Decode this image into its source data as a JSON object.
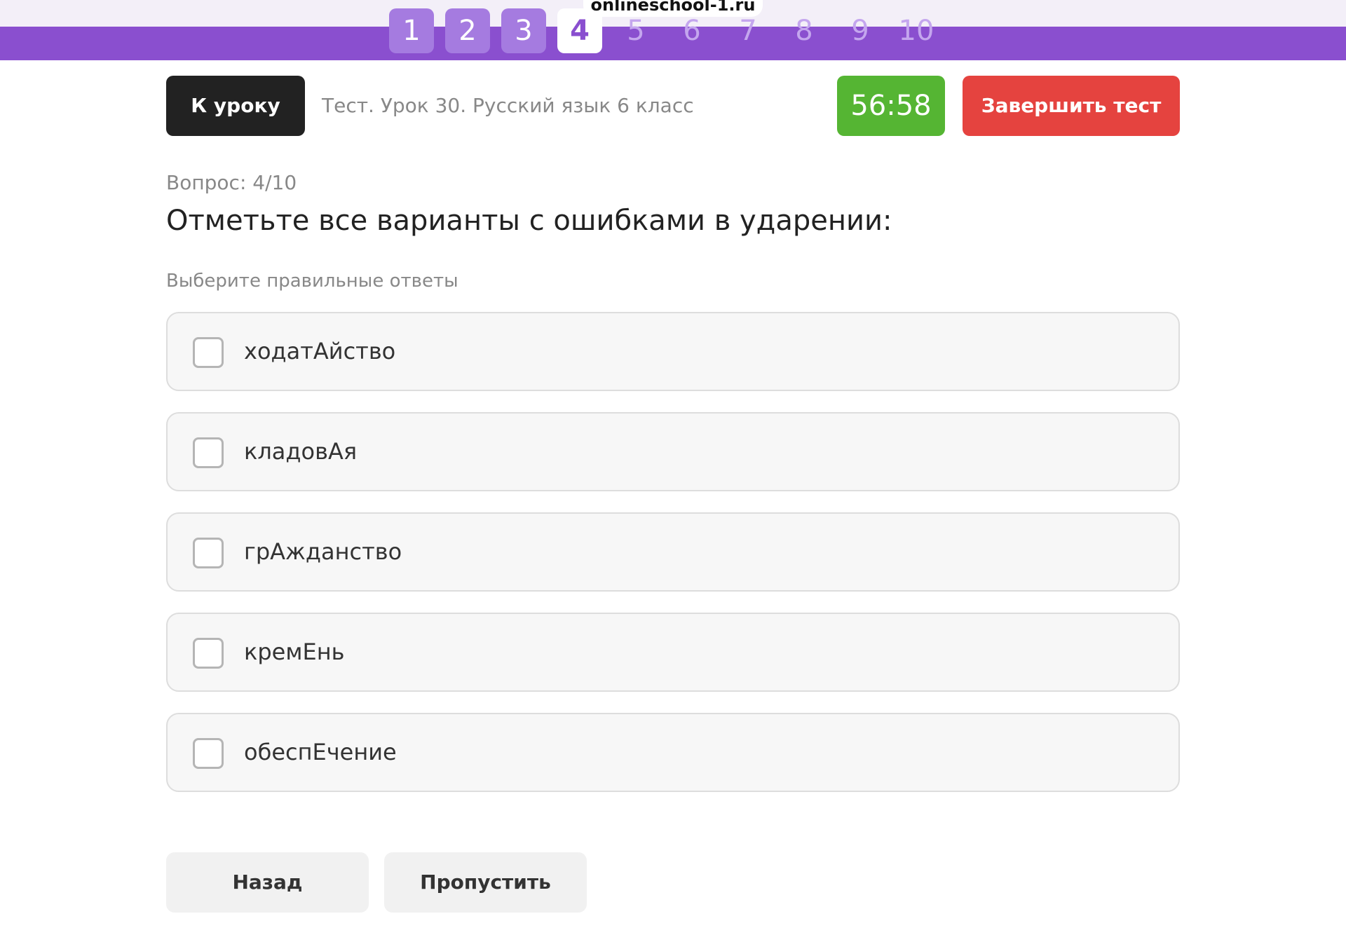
{
  "browser": {
    "url": "onlineschool-1.ru"
  },
  "nav": {
    "questions": [
      {
        "label": "1",
        "state": "done"
      },
      {
        "label": "2",
        "state": "done"
      },
      {
        "label": "3",
        "state": "done"
      },
      {
        "label": "4",
        "state": "active"
      },
      {
        "label": "5",
        "state": "pending"
      },
      {
        "label": "6",
        "state": "pending"
      },
      {
        "label": "7",
        "state": "pending"
      },
      {
        "label": "8",
        "state": "pending"
      },
      {
        "label": "9",
        "state": "pending"
      },
      {
        "label": "10",
        "state": "pending"
      }
    ]
  },
  "header": {
    "back_label": "К уроку",
    "test_title": "Тест. Урок 30. Русский язык 6 класс",
    "timer": "56:58",
    "finish_label": "Завершить тест"
  },
  "question": {
    "counter": "Вопрос: 4/10",
    "text": "Отметьте все варианты с ошибками в ударении:",
    "instruction": "Выберите правильные ответы",
    "options": [
      {
        "label": "ходатАйство",
        "checked": false
      },
      {
        "label": "кладовАя",
        "checked": false
      },
      {
        "label": "грАжданство",
        "checked": false
      },
      {
        "label": "кремЕнь",
        "checked": false
      },
      {
        "label": "обеспЕчение",
        "checked": false
      }
    ]
  },
  "footer": {
    "back_label": "Назад",
    "skip_label": "Пропустить"
  },
  "colors": {
    "nav_bar": "#8a4fcf",
    "timer": "#55b533",
    "finish": "#e5433f",
    "dark_button": "#222222"
  }
}
